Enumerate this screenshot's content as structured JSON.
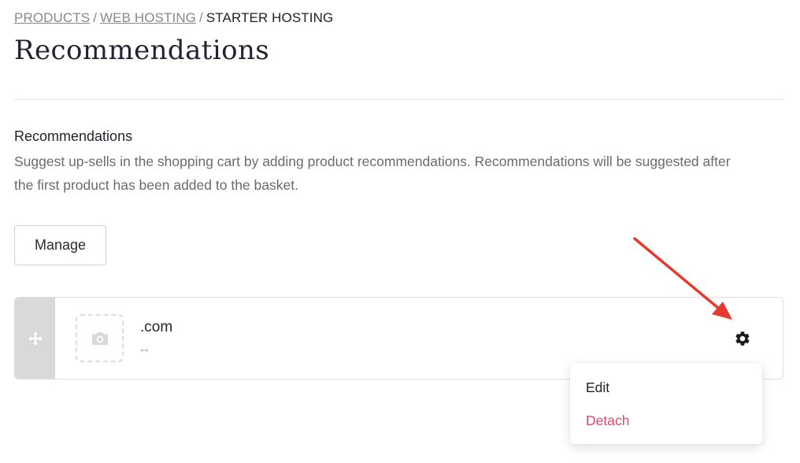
{
  "breadcrumb": {
    "items": [
      "PRODUCTS",
      "WEB HOSTING"
    ],
    "current": "STARTER HOSTING",
    "separator": "/"
  },
  "page": {
    "title": "Recommendations"
  },
  "section": {
    "heading": "Recommendations",
    "description": "Suggest up-sells in the shopping cart by adding product recommendations. Recommendations will be suggested after the first product has been added to the basket."
  },
  "actions": {
    "manage_label": "Manage"
  },
  "recommendation": {
    "title": ".com",
    "subtitle": "--",
    "icons": {
      "drag": "move-icon",
      "thumbnail": "camera-icon",
      "settings": "gear-icon"
    }
  },
  "menu": {
    "edit_label": "Edit",
    "detach_label": "Detach",
    "detach_color": "#e04a6b"
  },
  "annotation": {
    "arrow_color": "#e53a2f"
  }
}
